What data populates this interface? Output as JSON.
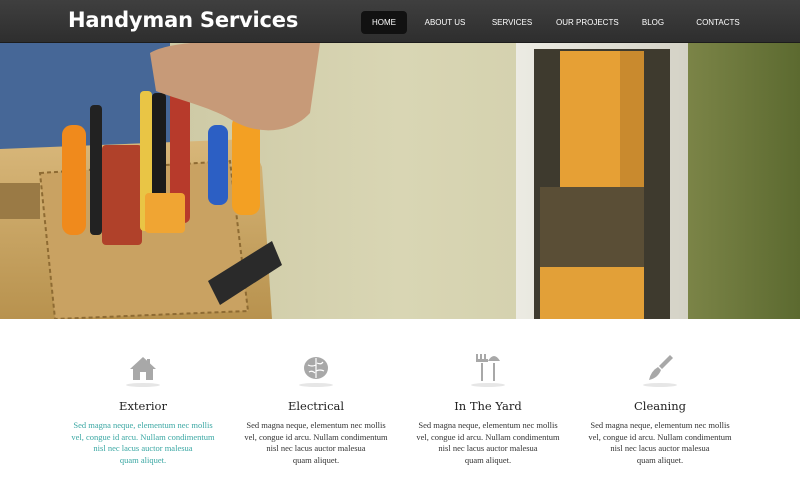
{
  "brand": {
    "title": "Handyman Services"
  },
  "nav": {
    "items": [
      "HOME",
      "ABOUT US",
      "SERVICES",
      "OUR PROJECTS",
      "BLOG",
      "CONTACTS"
    ],
    "active": "HOME"
  },
  "hero": {
    "image": "handyman-tool-belt-photo"
  },
  "features": [
    {
      "icon": "house-icon",
      "title": "Exterior",
      "text_lines": [
        "Sed magna neque, elementum nec mollis",
        "vel, congue id arcu. Nullam condimentum",
        "nisl nec lacus auctor malesua",
        "quam aliquet."
      ],
      "highlighted": true
    },
    {
      "icon": "brain-icon",
      "title": "Electrical",
      "text_lines": [
        "Sed magna neque, elementum nec mollis",
        "vel, congue id arcu. Nullam condimentum",
        "nisl nec lacus auctor malesua",
        "quam aliquet."
      ],
      "highlighted": false
    },
    {
      "icon": "garden-tools-icon",
      "title": "In The Yard",
      "text_lines": [
        "Sed magna neque, elementum nec mollis",
        "vel, congue id arcu. Nullam condimentum",
        "nisl nec lacus auctor malesua",
        "quam aliquet."
      ],
      "highlighted": false
    },
    {
      "icon": "paintbrush-icon",
      "title": "Cleaning",
      "text_lines": [
        "Sed magna neque, elementum nec mollis",
        "vel, congue id arcu. Nullam condimentum",
        "nisl nec lacus auctor malesua",
        "quam aliquet."
      ],
      "highlighted": false
    }
  ],
  "colors": {
    "accent_text": "#3aa7a3",
    "header_bg": "#353535",
    "active_nav_bg": "#111111"
  }
}
